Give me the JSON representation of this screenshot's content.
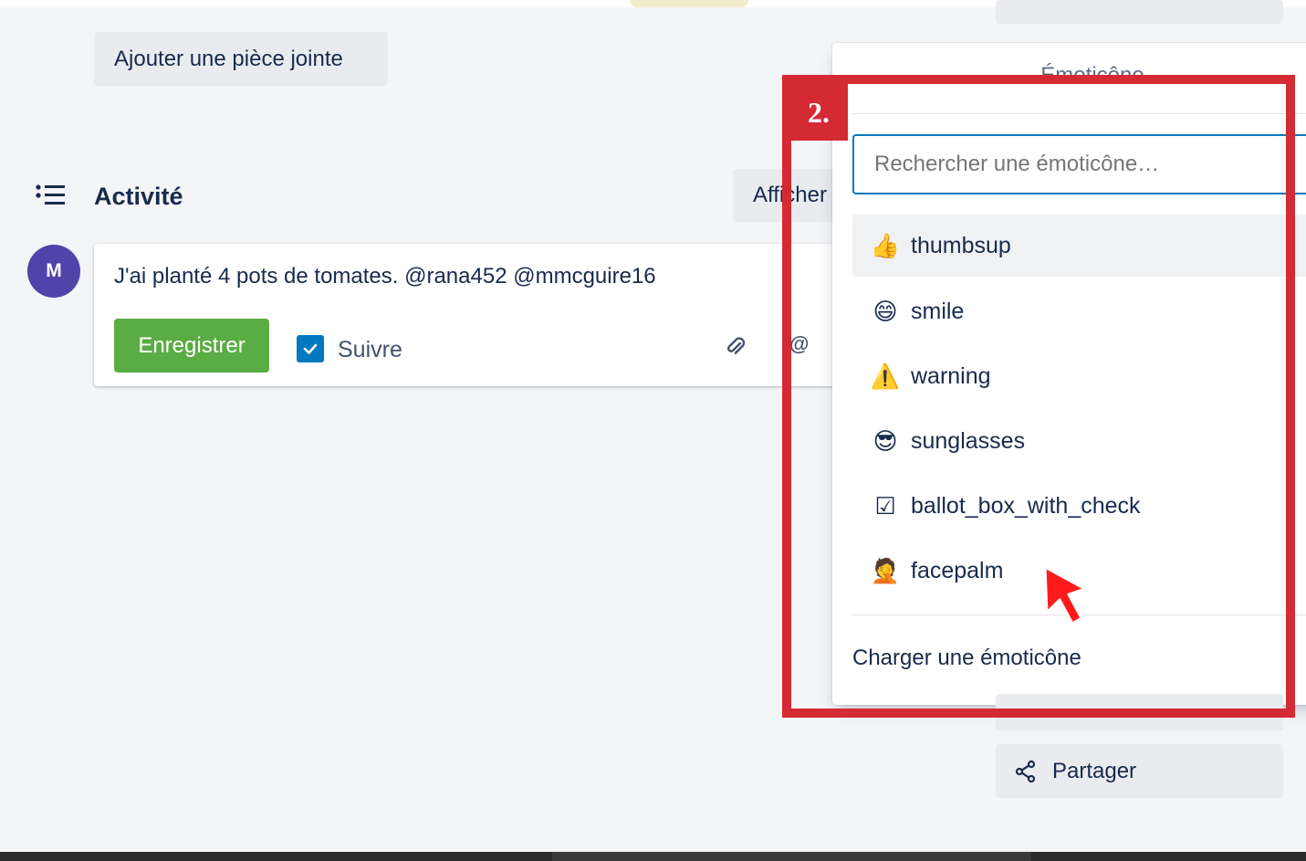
{
  "attachment": {
    "add_label": "Ajouter une pièce jointe"
  },
  "activity": {
    "title": "Activité",
    "show_details_label": "Afficher",
    "avatar_initial": "M",
    "comment_text": "J'ai planté 4 pots de tomates. @rana452 @mmcguire16",
    "save_label": "Enregistrer",
    "follow_label": "Suivre",
    "follow_checked": true,
    "mention_symbol": "@"
  },
  "emoji_picker": {
    "title": "Émoticône",
    "search_placeholder": "Rechercher une émoticône…",
    "items": [
      {
        "label": "thumbsup",
        "glyph": "👍",
        "active": true
      },
      {
        "label": "smile",
        "glyph": "😄"
      },
      {
        "label": "warning",
        "glyph": "⚠️"
      },
      {
        "label": "sunglasses",
        "glyph": "😎"
      },
      {
        "label": "ballot_box_with_check",
        "glyph": "☑"
      },
      {
        "label": "facepalm",
        "glyph": "🤦"
      }
    ],
    "upload_label": "Charger une émoticône"
  },
  "sidebar": {
    "share_label": "Partager"
  },
  "annotation": {
    "step_label": "2.",
    "color": "#d42a34"
  },
  "colors": {
    "save_button": "#5aac44",
    "checkbox": "#0079bf",
    "avatar": "#5243aa"
  }
}
